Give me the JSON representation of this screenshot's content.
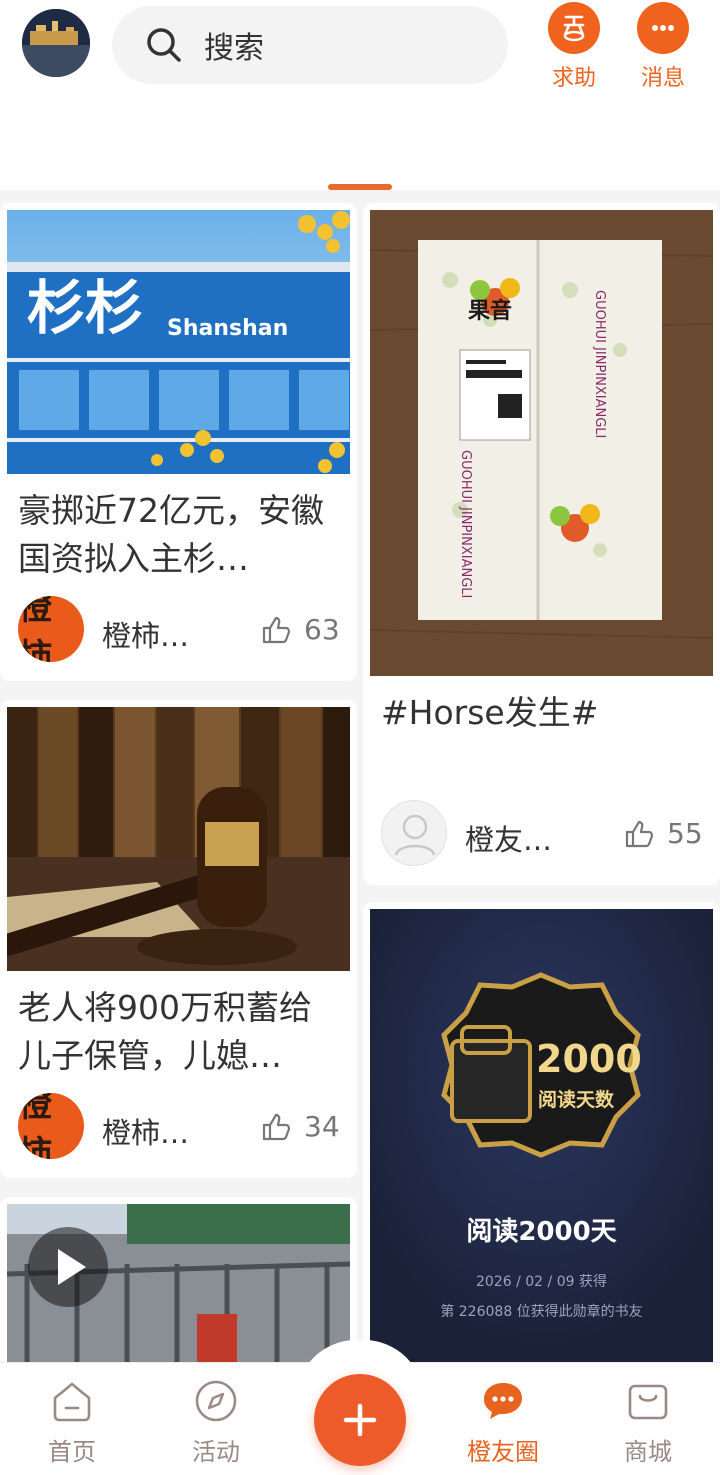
{
  "header": {
    "search_placeholder": "搜索",
    "help_label": "求助",
    "message_label": "消息",
    "accent_color": "#f0631e"
  },
  "feed": {
    "left": [
      {
        "title": "豪掷近72亿元，安徽国资拟入主杉…",
        "author": "橙柿…",
        "likes": "63",
        "image_text": "杉杉",
        "image_subtext": "Shanshan"
      },
      {
        "title": "老人将900万积蓄给儿子保管，儿媳…",
        "author": "橙柿…",
        "likes": "34"
      },
      {
        "video": true
      }
    ],
    "right": [
      {
        "title": "#Horse发生#",
        "author": "橙友…",
        "likes": "55",
        "image_box_brand": "果音",
        "image_box_pinyin": "GUOHUI JINPINXIANGLI"
      },
      {
        "badge_number": "2000",
        "badge_unit": "阅读天数",
        "badge_title": "阅读2000天",
        "badge_date": "2026 / 02 / 09 获得",
        "badge_rank": "第 226088 位获得此勋章的书友"
      }
    ]
  },
  "nav": {
    "home": "首页",
    "activity": "活动",
    "circle": "橙友圈",
    "mall": "商城",
    "active": "橙友圈"
  },
  "author_avatar_text": "橙柿"
}
